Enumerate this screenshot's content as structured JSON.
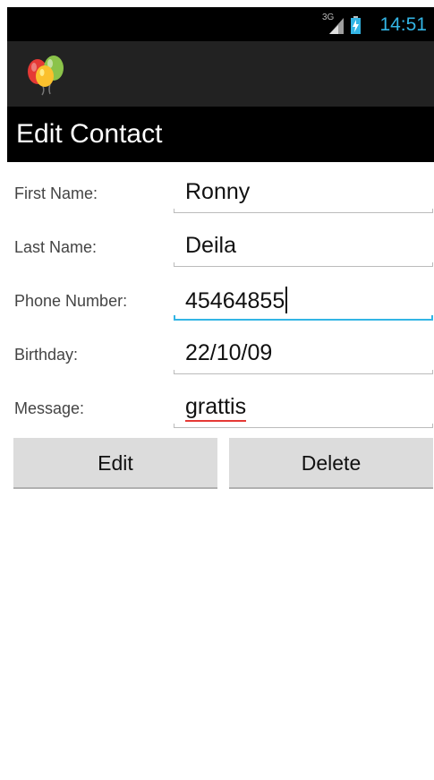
{
  "status_bar": {
    "network": "3G",
    "time": "14:51",
    "colors": {
      "accent": "#33b5e5",
      "background": "#000000"
    }
  },
  "action_bar": {
    "icon": "balloons-icon"
  },
  "title": "Edit Contact",
  "form": {
    "fields": [
      {
        "label": "First Name:",
        "value": "Ronny"
      },
      {
        "label": "Last Name:",
        "value": "Deila"
      },
      {
        "label": "Phone Number:",
        "value": "45464855"
      },
      {
        "label": "Birthday:",
        "value": "22/10/09"
      },
      {
        "label": "Message:",
        "value": "grattis"
      }
    ]
  },
  "buttons": {
    "edit": "Edit",
    "delete": "Delete"
  }
}
